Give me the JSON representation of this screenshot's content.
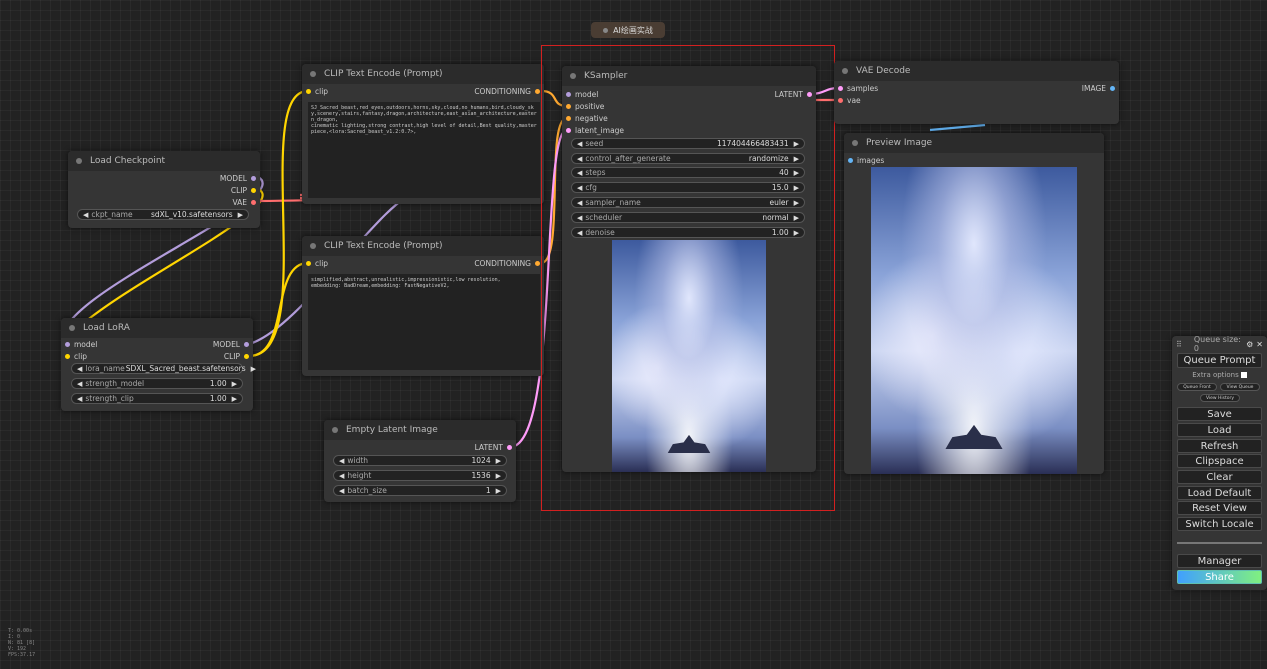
{
  "group": {
    "label": "AI绘画实战"
  },
  "load_checkpoint": {
    "title": "Load Checkpoint",
    "outputs": [
      "MODEL",
      "CLIP",
      "VAE"
    ],
    "ckpt_label": "ckpt_name",
    "ckpt_value": "sdXL_v10.safetensors"
  },
  "load_lora": {
    "title": "Load LoRA",
    "inputs": [
      "model",
      "clip"
    ],
    "outputs": [
      "MODEL",
      "CLIP"
    ],
    "widgets": [
      {
        "label": "lora_name",
        "value": "SDXL_Sacred_beast.safetensors"
      },
      {
        "label": "strength_model",
        "value": "1.00"
      },
      {
        "label": "strength_clip",
        "value": "1.00"
      }
    ]
  },
  "clip_pos": {
    "title": "CLIP Text Encode (Prompt)",
    "input": "clip",
    "output": "CONDITIONING",
    "text": "SJ_Sacred_beast,red_eyes,outdoors,horns,sky,cloud,no_humans,bird,cloudy_sky,scenery,stairs,fantasy,dragon,architecture,east_asian_architecture,eastern_dragon,\ncinematic lighting,strong contrast,high level of detail,Best quality,masterpiece,<lora:Sacred_beast_v1.2:0.7>,"
  },
  "clip_neg": {
    "title": "CLIP Text Encode (Prompt)",
    "input": "clip",
    "output": "CONDITIONING",
    "text": "simplified,abstract,unrealistic,impressionistic,low resolution,\nembedding: BadDream,embedding: FastNegativeV2,"
  },
  "empty_latent": {
    "title": "Empty Latent Image",
    "output": "LATENT",
    "widgets": [
      {
        "label": "width",
        "value": "1024"
      },
      {
        "label": "height",
        "value": "1536"
      },
      {
        "label": "batch_size",
        "value": "1"
      }
    ]
  },
  "ksampler": {
    "title": "KSampler",
    "inputs": [
      "model",
      "positive",
      "negative",
      "latent_image"
    ],
    "output": "LATENT",
    "widgets": [
      {
        "label": "seed",
        "value": "117404466483431"
      },
      {
        "label": "control_after_generate",
        "value": "randomize"
      },
      {
        "label": "steps",
        "value": "40"
      },
      {
        "label": "cfg",
        "value": "15.0"
      },
      {
        "label": "sampler_name",
        "value": "euler"
      },
      {
        "label": "scheduler",
        "value": "normal"
      },
      {
        "label": "denoise",
        "value": "1.00"
      }
    ]
  },
  "vae_decode": {
    "title": "VAE Decode",
    "inputs": [
      "samples",
      "vae"
    ],
    "output": "IMAGE"
  },
  "preview": {
    "title": "Preview Image",
    "input": "images"
  },
  "panel": {
    "queue_size": "Queue size: 0",
    "queue_prompt": "Queue Prompt",
    "extra_options": "Extra options",
    "queue_front": "Queue Front",
    "view_queue": "View Queue",
    "view_history": "View History",
    "buttons": [
      "Save",
      "Load",
      "Refresh",
      "Clipspace",
      "Clear",
      "Load Default",
      "Reset View",
      "Switch Locale"
    ],
    "manager": "Manager",
    "share": "Share"
  },
  "stats": [
    "T: 0.00s",
    "I: 0",
    "N: 81 [8]",
    "V: 192",
    "FPS:37.17"
  ],
  "colors": {
    "model": "#b39ddb",
    "clip": "#ffd500",
    "vae": "#ff6e6e",
    "conditioning": "#ffa931",
    "latent": "#ff9cf9",
    "image": "#64b5f6",
    "selection": "#d32020",
    "share_start": "#40a0ff",
    "share_end": "#80f080"
  }
}
